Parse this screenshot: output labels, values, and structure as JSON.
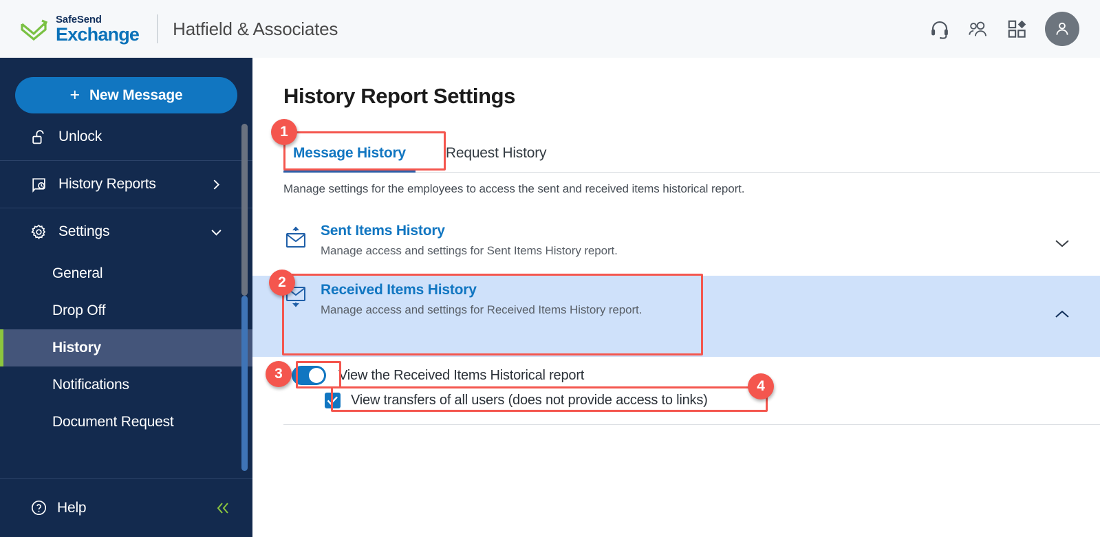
{
  "header": {
    "logo_top": "SafeSend",
    "logo_bottom": "Exchange",
    "org_name": "Hatfield & Associates",
    "icons": {
      "support": "headset-icon",
      "contacts": "users-icon",
      "apps": "apps-grid-icon",
      "profile": "user-avatar-icon"
    }
  },
  "sidebar": {
    "new_message_label": "New Message",
    "new_message_plus": "+",
    "items": [
      {
        "label": "Unlock",
        "icon": "unlock-icon",
        "chevron": ""
      },
      {
        "label": "History Reports",
        "icon": "history-report-icon",
        "chevron": "right"
      },
      {
        "label": "Settings",
        "icon": "gear-icon",
        "chevron": "down"
      }
    ],
    "sub_items": [
      {
        "label": "General",
        "active": false
      },
      {
        "label": "Drop Off",
        "active": false
      },
      {
        "label": "History",
        "active": true
      },
      {
        "label": "Notifications",
        "active": false
      },
      {
        "label": "Document Request",
        "active": false
      }
    ],
    "help_label": "Help",
    "help_icon": "question-circle-icon",
    "collapse_icon": "double-chevron-left-icon"
  },
  "main": {
    "page_title": "History Report Settings",
    "tabs": [
      {
        "label": "Message History",
        "active": true
      },
      {
        "label": "Request History",
        "active": false
      }
    ],
    "intro": "Manage settings for the employees to access the sent and received items historical report.",
    "sections": [
      {
        "title": "Sent Items History",
        "desc": "Manage access and settings for Sent Items History report.",
        "icon": "envelope-up-icon",
        "expanded": false,
        "chevron": "chevron-down-icon"
      },
      {
        "title": "Received Items History",
        "desc": "Manage access and settings for Received Items History report.",
        "icon": "envelope-down-icon",
        "expanded": true,
        "chevron": "chevron-up-icon"
      }
    ],
    "controls": {
      "toggle_label": "View the Received Items Historical report",
      "toggle_on": true,
      "checkbox_label": "View transfers of all users (does not provide access to links)",
      "checkbox_checked": true
    }
  },
  "annotations": {
    "accent_color": "#F4564E",
    "badges": [
      {
        "number": "1",
        "target": "message-history-tab"
      },
      {
        "number": "2",
        "target": "received-items-history-section"
      },
      {
        "number": "3",
        "target": "view-received-items-toggle"
      },
      {
        "number": "4",
        "target": "view-transfers-checkbox"
      }
    ]
  },
  "colors": {
    "sidebar_bg": "#132A4E",
    "sidebar_active": "#44557A",
    "accent_green": "#8CC63E",
    "primary_blue": "#1176C1",
    "section_highlight": "#CFE1FA"
  }
}
